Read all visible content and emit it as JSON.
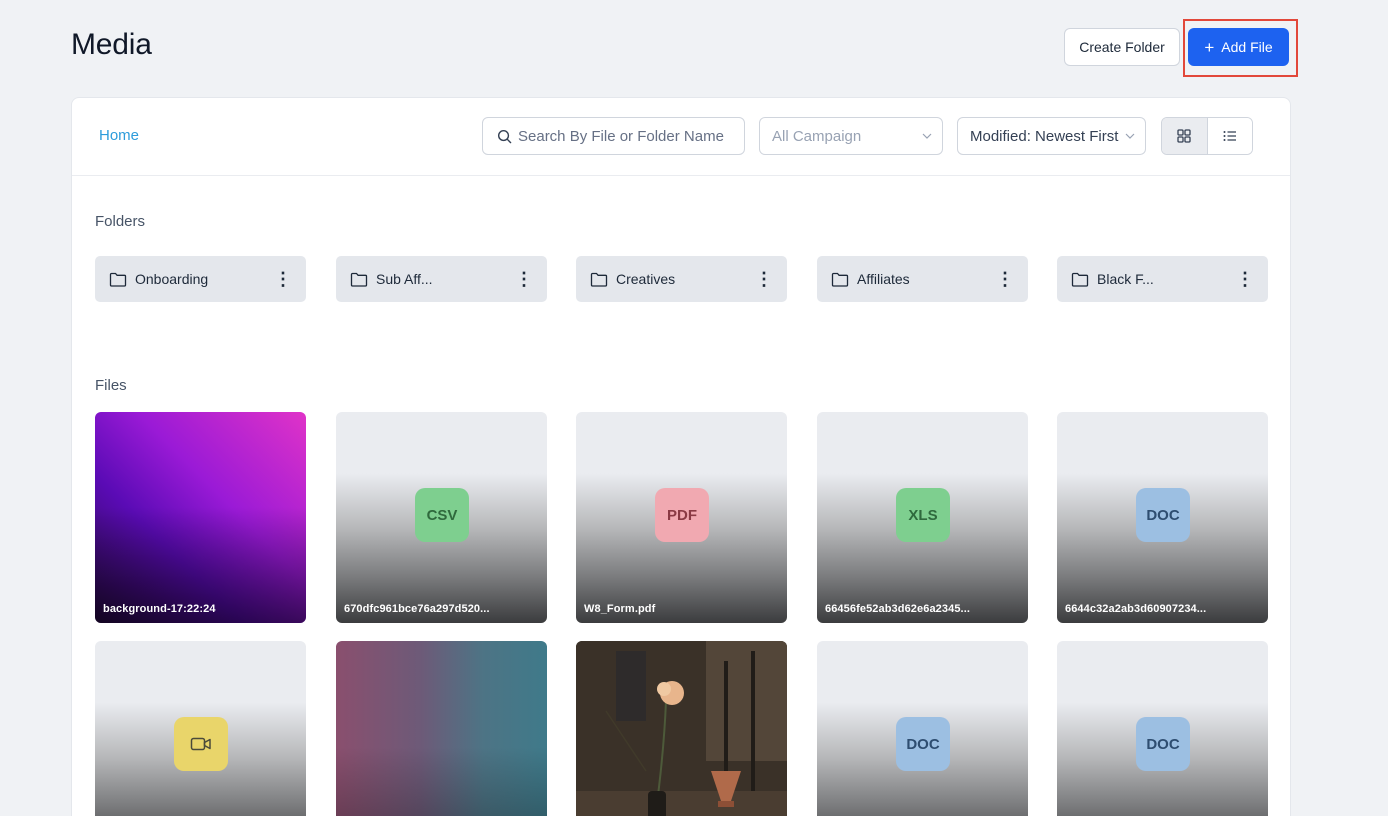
{
  "page": {
    "title": "Media"
  },
  "actions": {
    "create_folder_label": "Create Folder",
    "add_file_label": "Add File",
    "add_file_icon": "plus-icon"
  },
  "toolbar": {
    "breadcrumb_home": "Home",
    "search_placeholder": "Search By File or Folder Name",
    "campaign_value": "All Campaign",
    "sort_value": "Modified: Newest First",
    "view_modes": [
      "grid",
      "list"
    ],
    "active_view": "grid"
  },
  "sections": {
    "folders_label": "Folders",
    "files_label": "Files"
  },
  "folders": [
    {
      "name": "Onboarding"
    },
    {
      "name": "Sub Aff..."
    },
    {
      "name": "Creatives"
    },
    {
      "name": "Affiliates"
    },
    {
      "name": "Black F..."
    }
  ],
  "files": [
    {
      "caption": "background-17:22:24",
      "type": "image"
    },
    {
      "caption": "670dfc961bce76a297d520...",
      "type": "CSV"
    },
    {
      "caption": "W8_Form.pdf",
      "type": "PDF"
    },
    {
      "caption": "66456fe52ab3d62e6a2345...",
      "type": "XLS"
    },
    {
      "caption": "6644c32a2ab3d60907234...",
      "type": "DOC"
    },
    {
      "caption": "",
      "type": "video"
    },
    {
      "caption": "",
      "type": "image"
    },
    {
      "caption": "",
      "type": "image"
    },
    {
      "caption": "",
      "type": "DOC"
    },
    {
      "caption": "",
      "type": "DOC"
    }
  ],
  "colors": {
    "primary": "#1d62f0",
    "link": "#2d9cdb",
    "highlight": "#e2483a",
    "background": "#f0f2f5"
  }
}
